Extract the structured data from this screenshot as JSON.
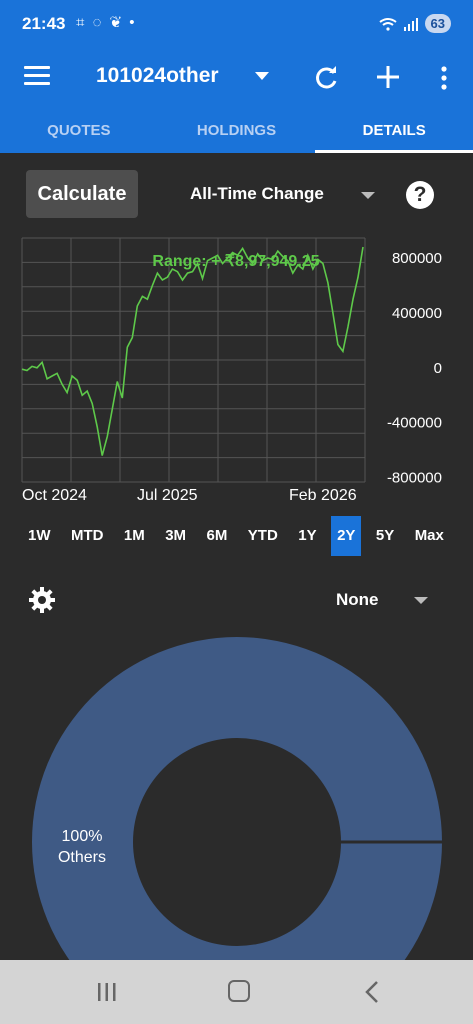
{
  "status": {
    "time": "21:43",
    "left_icons": "⌗ ◌ ❦ •",
    "battery": "63"
  },
  "toolbar": {
    "title": "101024other"
  },
  "tabs": [
    {
      "label": "QUOTES"
    },
    {
      "label": "HOLDINGS"
    },
    {
      "label": "DETAILS"
    }
  ],
  "controls": {
    "calculate_label": "Calculate",
    "change_mode": "All-Time Change",
    "help_label": "?"
  },
  "chart_data": {
    "type": "line",
    "annotation": "Range: + ₹8,97,949.25",
    "x_ticks": [
      "Oct 2024",
      "Jul 2025",
      "Feb 2026"
    ],
    "y_ticks": [
      "800000",
      "400000",
      "0",
      "-400000",
      "-800000"
    ],
    "ylim": [
      -800000,
      800000
    ],
    "series_color": "#5ec94a",
    "grid": true,
    "series": [
      {
        "values": [
          -10000,
          -20000,
          10000,
          0,
          40000,
          -80000,
          -60000,
          -40000,
          -120000,
          -180000,
          -60000,
          -90000,
          -200000,
          -170000,
          -260000,
          -430000,
          -640000,
          -500000,
          -300000,
          -100000,
          -220000,
          150000,
          220000,
          450000,
          520000,
          500000,
          600000,
          690000,
          640000,
          660000,
          720000,
          700000,
          640000,
          690000,
          700000,
          760000,
          650000,
          780000,
          800000,
          820000,
          760000,
          800000,
          840000,
          820000,
          870000,
          800000,
          760000,
          830000,
          780000,
          800000,
          790000,
          850000,
          810000,
          780000,
          690000,
          750000,
          720000,
          820000,
          720000,
          790000,
          760000,
          620000,
          400000,
          170000,
          120000,
          300000,
          500000,
          660000,
          880000
        ]
      }
    ]
  },
  "ranges": [
    {
      "label": "1W"
    },
    {
      "label": "MTD"
    },
    {
      "label": "1M"
    },
    {
      "label": "3M"
    },
    {
      "label": "6M"
    },
    {
      "label": "YTD"
    },
    {
      "label": "1Y"
    },
    {
      "label": "2Y",
      "active": true
    },
    {
      "label": "5Y"
    },
    {
      "label": "Max"
    }
  ],
  "grouping": {
    "selected": "None"
  },
  "donut": {
    "label": "100%\nOthers",
    "color": "#3f5a85"
  }
}
